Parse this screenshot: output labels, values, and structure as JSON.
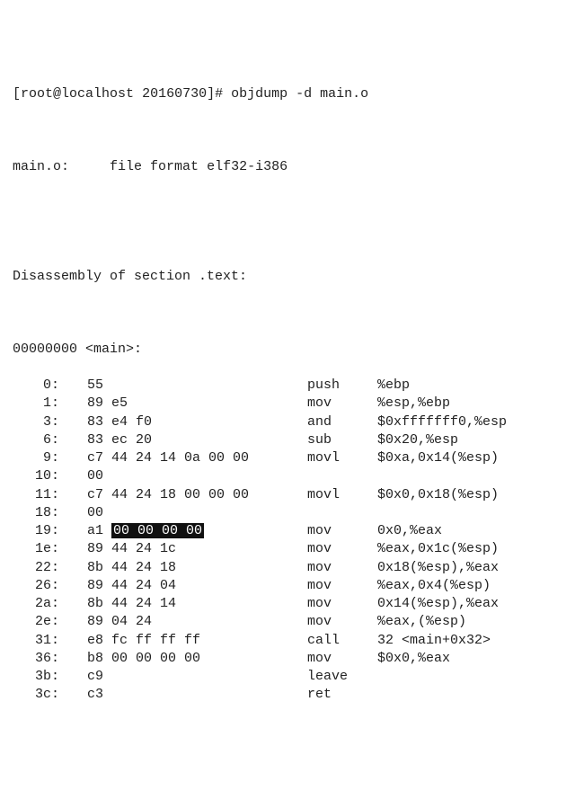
{
  "prompt": {
    "user": "root",
    "host": "localhost",
    "dir": "20160730",
    "cmd": "objdump -d main.o"
  },
  "header": {
    "file": "main.o:",
    "fmt_label": "file format",
    "fmt": "elf32-i386"
  },
  "section": {
    "label": "Disassembly of section .text:"
  },
  "symbol": {
    "addr": "00000000",
    "name": "<main>:"
  },
  "lines": [
    {
      "addr": "0:",
      "bytes": "55",
      "op": "push",
      "args": "%ebp"
    },
    {
      "addr": "1:",
      "bytes": "89 e5",
      "op": "mov",
      "args": "%esp,%ebp"
    },
    {
      "addr": "3:",
      "bytes": "83 e4 f0",
      "op": "and",
      "args": "$0xfffffff0,%esp"
    },
    {
      "addr": "6:",
      "bytes": "83 ec 20",
      "op": "sub",
      "args": "$0x20,%esp"
    },
    {
      "addr": "9:",
      "bytes": "c7 44 24 14 0a 00 00",
      "op": "movl",
      "args": "$0xa,0x14(%esp)"
    },
    {
      "addr": "10:",
      "bytes": "00",
      "op": "",
      "args": ""
    },
    {
      "addr": "11:",
      "bytes": "c7 44 24 18 00 00 00",
      "op": "movl",
      "args": "$0x0,0x18(%esp)"
    },
    {
      "addr": "18:",
      "bytes": "00",
      "op": "",
      "args": ""
    },
    {
      "addr": "19:",
      "bytes_pre": "a1 ",
      "bytes_hl": "00 00 00 00",
      "bytes_post": " ",
      "op": "mov",
      "args": "0x0,%eax"
    },
    {
      "addr": "1e:",
      "bytes": "89 44 24 1c",
      "op": "mov",
      "args": "%eax,0x1c(%esp)"
    },
    {
      "addr": "22:",
      "bytes": "8b 44 24 18",
      "op": "mov",
      "args": "0x18(%esp),%eax"
    },
    {
      "addr": "26:",
      "bytes": "89 44 24 04",
      "op": "mov",
      "args": "%eax,0x4(%esp)"
    },
    {
      "addr": "2a:",
      "bytes": "8b 44 24 14",
      "op": "mov",
      "args": "0x14(%esp),%eax"
    },
    {
      "addr": "2e:",
      "bytes": "89 04 24",
      "op": "mov",
      "args": "%eax,(%esp)"
    },
    {
      "addr": "31:",
      "bytes": "e8 fc ff ff ff",
      "op": "call",
      "args": "32 <main+0x32>"
    },
    {
      "addr": "36:",
      "bytes": "b8 00 00 00 00",
      "op": "mov",
      "args": "$0x0,%eax"
    },
    {
      "addr": "3b:",
      "bytes": "c9",
      "op": "leave",
      "args": ""
    },
    {
      "addr": "3c:",
      "bytes": "c3",
      "op": "ret",
      "args": ""
    }
  ]
}
